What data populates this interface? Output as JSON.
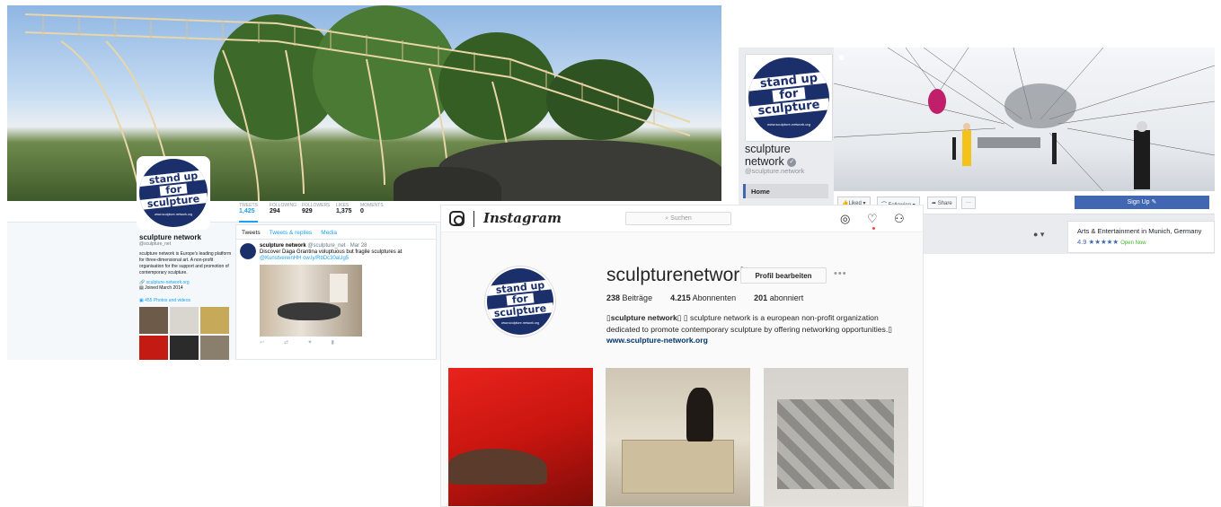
{
  "twitter": {
    "stats": [
      {
        "label": "TWEETS",
        "value": "1,425"
      },
      {
        "label": "FOLLOWING",
        "value": "294"
      },
      {
        "label": "FOLLOWERS",
        "value": "929"
      },
      {
        "label": "LIKES",
        "value": "1,375"
      },
      {
        "label": "MOMENTS",
        "value": "0"
      }
    ],
    "profile": {
      "name": "sculpture network",
      "handle": "@sculpture_net",
      "bio": "sculpture network is Europe's leading platform for three-dimensional art. A non-profit organisation for the support and promotion of contemporary sculpture.",
      "website": "sculpture-network.org",
      "joined": "Joined March 2014",
      "media_link": "455 Photos and videos"
    },
    "tabs": [
      "Tweets",
      "Tweets & replies",
      "Media"
    ],
    "tweet": {
      "author": "sculpture network",
      "meta": "@sculpture_net · Mar 28",
      "text": "Discover Daga Grantina voluptuous but fragile sculptures at",
      "link": "@KunstvereinHH ow.ly/RbDc30aUg5"
    }
  },
  "logo": {
    "line1": "stand up",
    "line2": "for",
    "line3": "sculpture",
    "url": "www.sculpture-network.org"
  },
  "facebook": {
    "name_line1": "sculpture",
    "name_line2": "network",
    "handle": "@sculpture.network",
    "nav_home": "Home",
    "buttons": {
      "liked": "Liked ▾",
      "following": "Following ▾",
      "share": "Share",
      "more": "···"
    },
    "signup": "Sign Up",
    "info": {
      "category": "Arts & Entertainment in Munich, Germany",
      "rating": "4.9 ★★★★★",
      "status": "Open Now"
    }
  },
  "instagram": {
    "wordmark": "Instagram",
    "search_placeholder": "Suchen",
    "username": "sculpturenetwork",
    "edit_button": "Profil bearbeiten",
    "more": "•••",
    "stats": [
      {
        "value": "238",
        "label": "Beiträge"
      },
      {
        "value": "4.215",
        "label": "Abonnenten"
      },
      {
        "value": "201",
        "label": "abonniert"
      }
    ],
    "bio_name": "sculpture network",
    "bio_text": "sculpture network is a european non-profit organization dedicated to promote contemporary sculpture by offering networking opportunities.",
    "bio_link": "www.sculpture-network.org"
  }
}
